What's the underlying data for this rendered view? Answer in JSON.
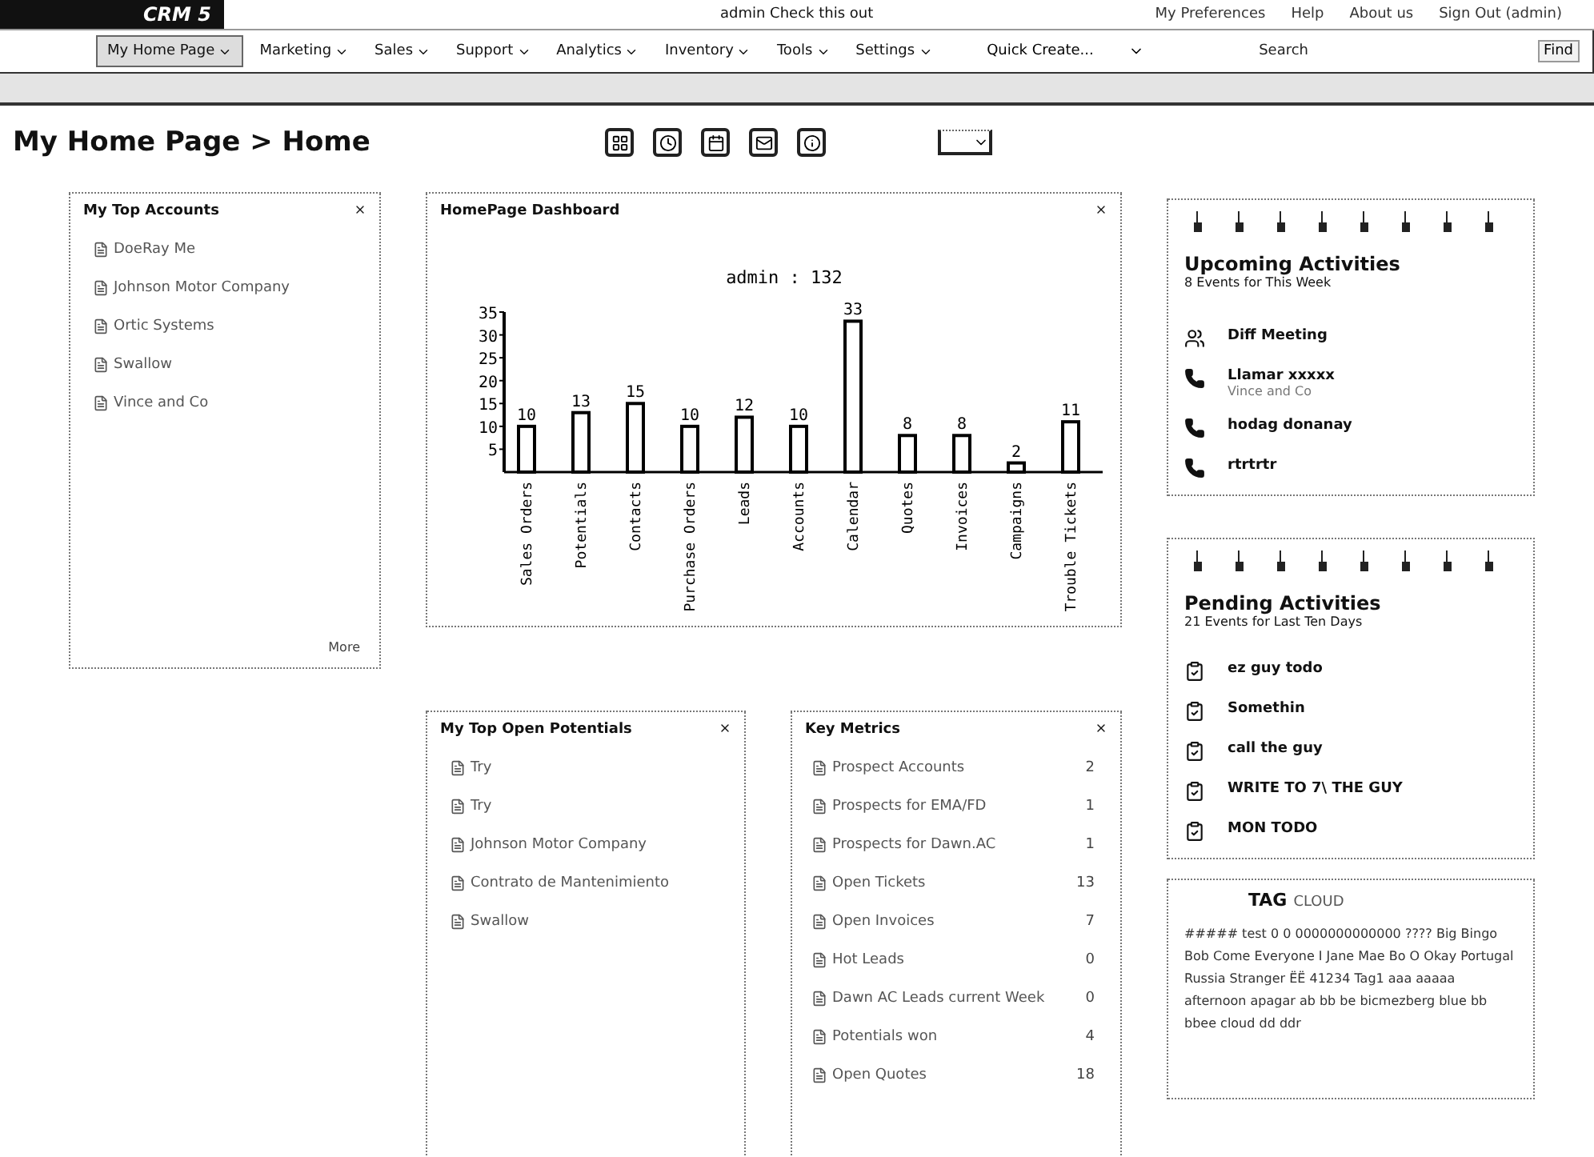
{
  "header": {
    "logo": "CRM 5",
    "message": "admin  Check this out",
    "links": [
      "My Preferences",
      "Help",
      "About us",
      "Sign Out (admin)"
    ]
  },
  "nav": {
    "tabs": [
      {
        "label": "My Home Page",
        "selected": true
      },
      {
        "label": "Marketing",
        "selected": false
      },
      {
        "label": "Sales",
        "selected": false
      },
      {
        "label": "Support",
        "selected": false
      },
      {
        "label": "Analytics",
        "selected": false
      },
      {
        "label": "Inventory",
        "selected": false
      },
      {
        "label": "Tools",
        "selected": false
      },
      {
        "label": "Settings",
        "selected": false
      }
    ],
    "quick_create": "Quick Create...",
    "search": {
      "placeholder": "Search"
    },
    "find_button": "Find"
  },
  "page_title": "My Home Page > Home",
  "top_accounts": {
    "title": "My Top Accounts",
    "items": [
      "DoeRay Me",
      "Johnson Motor Company",
      "Ortic Systems",
      "Swallow",
      "Vince and Co"
    ],
    "more": "More"
  },
  "dashboard": {
    "title": "HomePage Dashboard",
    "chart_data": {
      "type": "bar",
      "title": "admin : 132",
      "categories": [
        "Sales Orders",
        "Potentials",
        "Contacts",
        "Purchase Orders",
        "Leads",
        "Accounts",
        "Calendar",
        "Quotes",
        "Invoices",
        "Campaigns",
        "Trouble Tickets"
      ],
      "series": [
        {
          "color": "#ffffff",
          "values": [
            10,
            13,
            15,
            10,
            12,
            10,
            33,
            8,
            8,
            2,
            11
          ]
        }
      ],
      "ylim": [
        0,
        35
      ],
      "yticks": [
        5,
        10,
        15,
        20,
        25,
        30,
        35
      ],
      "data_labels": true
    }
  },
  "top_potentials": {
    "title": "My Top Open Potentials",
    "items": [
      "Try",
      "Try",
      "Johnson Motor Company",
      "Contrato de Mantenimiento",
      "Swallow"
    ]
  },
  "key_metrics": {
    "title": "Key Metrics",
    "rows": [
      {
        "name": "Prospect Accounts",
        "count": "2"
      },
      {
        "name": "Prospects for EMA/FD",
        "count": "1"
      },
      {
        "name": "Prospects for Dawn.AC",
        "count": "1"
      },
      {
        "name": "Open Tickets",
        "count": "13"
      },
      {
        "name": "Open Invoices",
        "count": "7"
      },
      {
        "name": "Hot Leads",
        "count": "0"
      },
      {
        "name": "Dawn AC Leads current Week",
        "count": "0"
      },
      {
        "name": "Potentials won",
        "count": "4"
      },
      {
        "name": "Open Quotes",
        "count": "18"
      }
    ]
  },
  "upcoming": {
    "title": "Upcoming Activities",
    "subtitle": "8 Events for This Week",
    "events": [
      {
        "kind": "meeting",
        "title": "Diff Meeting"
      },
      {
        "kind": "call",
        "title": "Llamar xxxxx",
        "detail": "Vince and Co"
      },
      {
        "kind": "call",
        "title": "hodag donanay"
      },
      {
        "kind": "call",
        "title": "rtrtrtr"
      }
    ]
  },
  "pending": {
    "title": "Pending Activities",
    "subtitle": "21 Events for Last Ten Days",
    "tasks": [
      "ez guy todo",
      "Somethin",
      "call the guy",
      "WRITE TO 7\\ THE GUY",
      "MON TODO"
    ]
  },
  "tag_cloud": {
    "title_bold": "TAG",
    "title_rest": "CLOUD",
    "text": "##### test 0 0 0000000000000 ???? Big Bingo Bob Come Everyone I Jane Mae Bo O Okay Portugal Russia Stranger ЁЁ 41234 Tag1 aaa aaaaa afternoon apagar ab bb be bicmezberg blue bb bbee cloud dd ddr"
  }
}
